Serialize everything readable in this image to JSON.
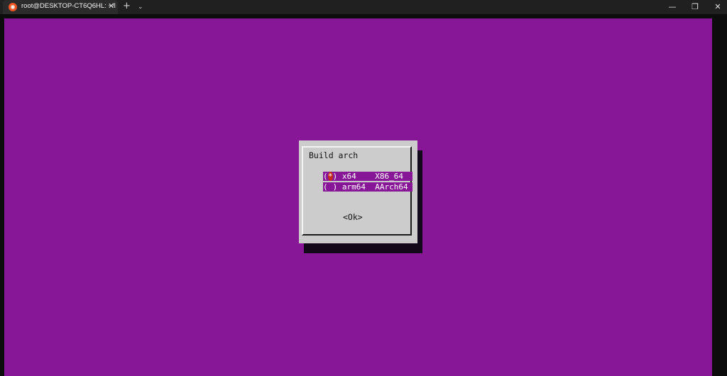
{
  "window": {
    "tab_title": "root@DESKTOP-CT6Q6HL: ~/l",
    "tab_close_glyph": "✕",
    "new_tab_glyph": "+",
    "dropdown_glyph": "⌄",
    "minimize_glyph": "—",
    "maximize_glyph": "❐",
    "close_glyph": "✕",
    "tab_icon": "ubuntu-icon"
  },
  "terminal": {
    "background_color": "#881798"
  },
  "dialog": {
    "title": "Build arch",
    "options": [
      {
        "open": "(",
        "mark": "*",
        "close": ")",
        "name": "x64",
        "desc": "X86_64",
        "selected": true
      },
      {
        "open": "(",
        "mark": " ",
        "close": ")",
        "name": "arm64",
        "desc": "AArch64",
        "selected": false
      }
    ],
    "ok_label": "<Ok>"
  }
}
